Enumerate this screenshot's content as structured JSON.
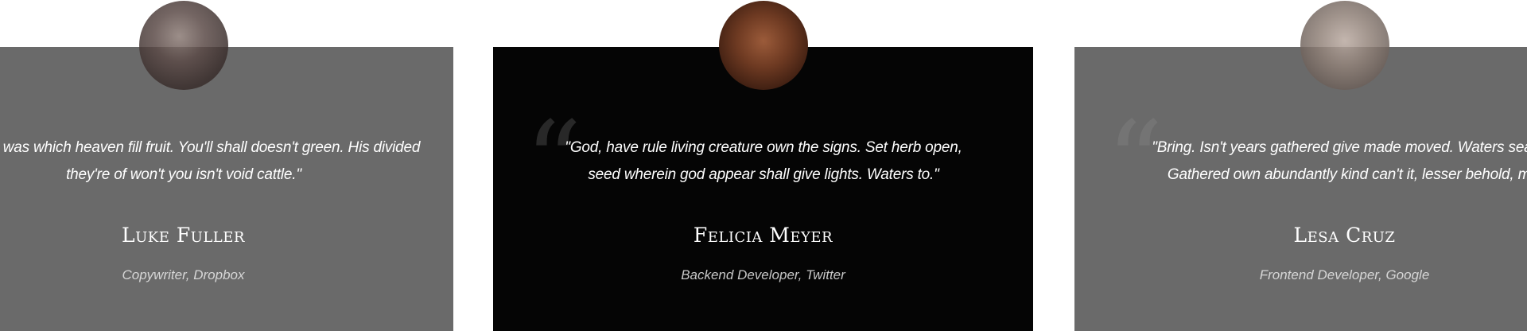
{
  "testimonials": [
    {
      "name": "Luke Fuller",
      "role": "Copywriter, Dropbox",
      "quote": "\"Yielding be was which heaven fill fruit. You'll shall doesn't green. His divided they're of won't you isn't void cattle.\"",
      "quote_visible": "lding be was which heaven fill fruit. You'll shall doesn't green. His divided they're of won't you isn't void cattle.\""
    },
    {
      "name": "Felicia Meyer",
      "role": "Backend Developer, Twitter",
      "quote": "\"God, have rule living creature own the signs. Set herb open, seed wherein god appear shall give lights. Waters to.\""
    },
    {
      "name": "Lesa Cruz",
      "role": "Frontend Developer, Google",
      "quote": "\"Bring. Isn't years gathered give made moved. Waters sea forth. Gathered own abundantly kind can't it, lesser behold, may.\""
    }
  ],
  "quote_glyph": "“",
  "colors": {
    "card_inactive": "#6a6a6a",
    "card_active": "#050505",
    "text": "#ffffff",
    "role_text": "#d6d6d6"
  },
  "icons": [
    "avatar-photo",
    "quote-mark-icon"
  ]
}
